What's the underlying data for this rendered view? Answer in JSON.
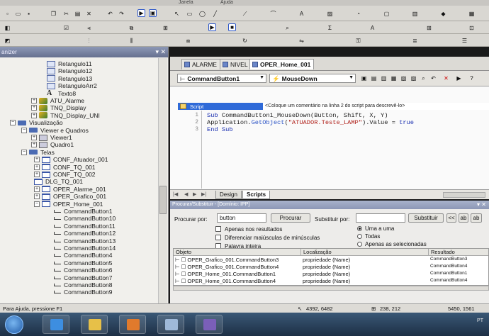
{
  "menubar": {
    "items": [
      "Janela",
      "Ajuda"
    ]
  },
  "tree": {
    "title": "anizer",
    "nodes": [
      {
        "label": "Retangulo11",
        "icon": "rect-icon"
      },
      {
        "label": "Retangulo12",
        "icon": "rect-icon"
      },
      {
        "label": "Retangulo13",
        "icon": "rect-icon"
      },
      {
        "label": "RetanguloArr2",
        "icon": "rect-icon"
      },
      {
        "label": "Texto8",
        "icon": "text-icon"
      },
      {
        "label": "ATU_Alarme",
        "icon": "object-icon"
      },
      {
        "label": "TNQ_Display",
        "icon": "object-icon"
      },
      {
        "label": "TNQ_Display_UNI",
        "icon": "object-icon"
      },
      {
        "label": "Visualização",
        "icon": "folder-icon"
      },
      {
        "label": "Viewer e Quadros",
        "icon": "folder-icon"
      },
      {
        "label": "Viewer1",
        "icon": "viewer-icon"
      },
      {
        "label": "Quadro1",
        "icon": "viewer-icon"
      },
      {
        "label": "Telas",
        "icon": "folder-icon"
      },
      {
        "label": "CONF_Atuador_001",
        "icon": "screen-icon"
      },
      {
        "label": "CONF_TQ_001",
        "icon": "screen-icon"
      },
      {
        "label": "CONF_TQ_002",
        "icon": "screen-icon"
      },
      {
        "label": "DLG_TQ_001",
        "icon": "screen-icon"
      },
      {
        "label": "OPER_Alarme_001",
        "icon": "screen-icon"
      },
      {
        "label": "OPER_Grafico_001",
        "icon": "screen-icon"
      },
      {
        "label": "OPER_Home_001",
        "icon": "screen-icon"
      },
      {
        "label": "CommandButton1",
        "icon": "button-icon"
      },
      {
        "label": "CommandButton10",
        "icon": "button-icon"
      },
      {
        "label": "CommandButton11",
        "icon": "button-icon"
      },
      {
        "label": "CommandButton12",
        "icon": "button-icon"
      },
      {
        "label": "CommandButton13",
        "icon": "button-icon"
      },
      {
        "label": "CommandButton14",
        "icon": "button-icon"
      },
      {
        "label": "CommandButton4",
        "icon": "button-icon"
      },
      {
        "label": "CommandButton5",
        "icon": "button-icon"
      },
      {
        "label": "CommandButton6",
        "icon": "button-icon"
      },
      {
        "label": "CommandButton7",
        "icon": "button-icon"
      },
      {
        "label": "CommandButton8",
        "icon": "button-icon"
      },
      {
        "label": "CommandButton9",
        "icon": "button-icon"
      }
    ]
  },
  "doc_tabs": [
    {
      "label": "ALARME",
      "active": false
    },
    {
      "label": "NIVEL",
      "active": false
    },
    {
      "label": "OPER_Home_001",
      "active": true
    }
  ],
  "script_bar": {
    "object": "CommandButton1",
    "event": "MouseDown"
  },
  "editor": {
    "script_tab": "Script",
    "comment_hint": "<Coloque um comentário na linha 2 do script para descrevê-lo>",
    "lines": [
      {
        "num": "1",
        "parts": [
          [
            "kw",
            "Sub "
          ],
          [
            "pl",
            "CommandButton1_MouseDown(Button, Shift, X, Y)"
          ]
        ]
      },
      {
        "num": "2",
        "parts": [
          [
            "pl",
            "Application."
          ],
          [
            "fn",
            "GetObject"
          ],
          [
            "pl",
            "("
          ],
          [
            "st",
            "\"ATUADOR.Teste_LAMP\""
          ],
          [
            "pl",
            ").Value = "
          ],
          [
            "kw",
            "true"
          ]
        ]
      },
      {
        "num": "3",
        "parts": [
          [
            "kw",
            "End Sub"
          ]
        ]
      }
    ]
  },
  "bottom_tabs": {
    "design": "Design",
    "scripts": "Scripts"
  },
  "find": {
    "title": "Procurar/Substituir - [Domínio: IPP]",
    "search_label": "Procurar por:",
    "search_value": "button",
    "search_button": "Procurar",
    "replace_label": "Substituir por:",
    "replace_value": "",
    "replace_button": "Substituir",
    "options": [
      "Apenas nos resultados",
      "Diferenciar maiúsculas de minúsculas",
      "Palavra inteira"
    ],
    "modes": [
      {
        "label": "Uma a uma",
        "selected": true
      },
      {
        "label": "Todas",
        "selected": false
      },
      {
        "label": "Apenas as selecionadas",
        "selected": false
      }
    ],
    "columns": [
      "Objeto",
      "Localização",
      "Resultado"
    ],
    "rows": [
      {
        "objeto": "OPER_Grafico_001.CommandButton3",
        "local": "propriedade (Name)",
        "resultado": "CommandButton3"
      },
      {
        "objeto": "OPER_Grafico_001.CommandButton4",
        "local": "propriedade (Name)",
        "resultado": "CommandButton4"
      },
      {
        "objeto": "OPER_Home_001.CommandButton1",
        "local": "propriedade (Name)",
        "resultado": "CommandButton1"
      },
      {
        "objeto": "OPER_Home_001.CommandButton4",
        "local": "propriedade (Name)",
        "resultado": "CommandButton4"
      }
    ]
  },
  "status": {
    "help": "Para Ajuda, pressione F1",
    "coord1": "4392, 6482",
    "coord2": "238, 212",
    "coord3": "5450, 1561",
    "lang": "PT"
  },
  "colors": {
    "selection": "#2f6ad8",
    "keyword": "#1a2fb0",
    "string": "#b0201a",
    "taskbar": "#1d2f45"
  }
}
